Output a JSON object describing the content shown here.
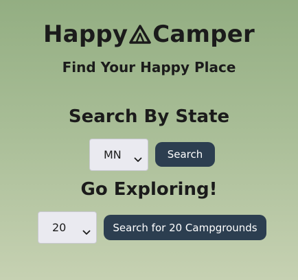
{
  "header": {
    "brand_part1": "Happy",
    "brand_part2": "Camper",
    "logo_icon": "tent-icon",
    "tagline": "Find Your Happy Place"
  },
  "state_search": {
    "title": "Search By State",
    "selected_state": "MN",
    "button_label": "Search"
  },
  "explore": {
    "title": "Go Exploring!",
    "selected_count": "20",
    "button_label": "Search for 20 Campgrounds"
  },
  "colors": {
    "button_bg": "#2c3e50",
    "select_bg": "#eaeaf0",
    "background_top": "#93ae82",
    "background_bottom": "#c6d1b2"
  }
}
